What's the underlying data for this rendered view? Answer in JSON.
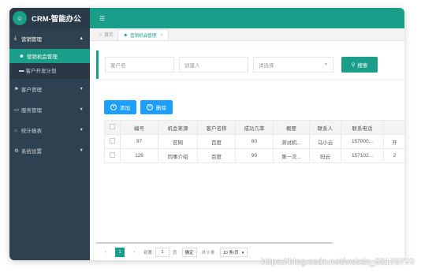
{
  "brand": {
    "title": "CRM-智能办公",
    "logo_icon": "robot-icon"
  },
  "sidebar": {
    "groups": [
      {
        "label": "营销管理",
        "icon": "download-icon",
        "open": true,
        "items": [
          {
            "label": "营销机会管理",
            "active": true
          },
          {
            "label": "客户开发计划",
            "active": false
          }
        ]
      },
      {
        "label": "客户管理",
        "icon": "flag-icon"
      },
      {
        "label": "服务管理",
        "icon": "monitor-icon"
      },
      {
        "label": "统计报表",
        "icon": "home-icon"
      },
      {
        "label": "系统设置",
        "icon": "gear-icon"
      }
    ]
  },
  "tabs": [
    {
      "label": "首页",
      "active": false
    },
    {
      "label": "营销机会管理",
      "active": true
    }
  ],
  "search": {
    "customer_placeholder": "客户名",
    "creator_placeholder": "创建人",
    "select_placeholder": "请选择",
    "search_label": "搜索"
  },
  "actions": {
    "add_label": "添加",
    "delete_label": "删除"
  },
  "table": {
    "headers": [
      "编号",
      "机会来源",
      "客户名称",
      "成功几率",
      "概要",
      "联系人",
      "联系电话"
    ],
    "rows": [
      [
        "97",
        "官网",
        "百度",
        "80",
        "测试机...",
        "乌小云",
        "157000..."
      ],
      [
        "126",
        "同事介绍",
        "百度",
        "90",
        "第一次...",
        "码云",
        "157102..."
      ]
    ],
    "overflow_cells": [
      "开",
      "2"
    ]
  },
  "pager": {
    "current_page": "1",
    "goto_label": "到第",
    "goto_value": "1",
    "page_unit": "页",
    "confirm_label": "确定",
    "total_label": "共 2 条",
    "page_size_label": "10 条/页"
  },
  "watermark": "https://blog.csdn.net/weixin_53173799",
  "colors": {
    "accent": "#1a9e89",
    "sidebar": "#2f4050",
    "primary_button": "#1e9fff"
  }
}
